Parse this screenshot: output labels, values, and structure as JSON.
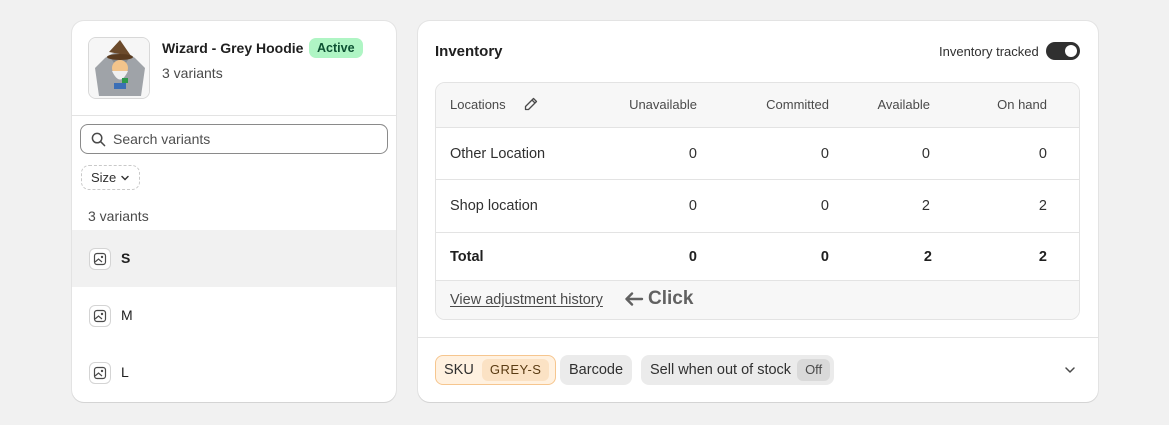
{
  "product": {
    "title": "Wizard - Grey Hoodie",
    "status": "Active",
    "variant_count": "3 variants"
  },
  "variants_panel": {
    "search_placeholder": "Search variants",
    "filter_label": "Size",
    "count_label": "3 variants",
    "items": [
      {
        "label": "S",
        "selected": true
      },
      {
        "label": "M",
        "selected": false
      },
      {
        "label": "L",
        "selected": false
      }
    ]
  },
  "inventory": {
    "title": "Inventory",
    "tracked_label": "Inventory tracked",
    "tracked": true,
    "columns": [
      "Locations",
      "Unavailable",
      "Committed",
      "Available",
      "On hand"
    ],
    "rows": [
      {
        "location": "Other Location",
        "unavailable": "0",
        "committed": "0",
        "available": "0",
        "on_hand": "0"
      },
      {
        "location": "Shop location",
        "unavailable": "0",
        "committed": "0",
        "available": "2",
        "on_hand": "2"
      }
    ],
    "total": {
      "label": "Total",
      "unavailable": "0",
      "committed": "0",
      "available": "2",
      "on_hand": "2"
    },
    "history_link": "View adjustment history",
    "annotation": "Click"
  },
  "details": {
    "sku_label": "SKU",
    "sku_value": "GREY-S",
    "barcode_label": "Barcode",
    "sell_oos_label": "Sell when out of stock",
    "sell_oos_value": "Off"
  },
  "colors": {
    "active_badge_bg": "#aff5c4",
    "sku_highlight_bg": "#fff1e0",
    "sku_highlight_border": "#f6c68f"
  }
}
